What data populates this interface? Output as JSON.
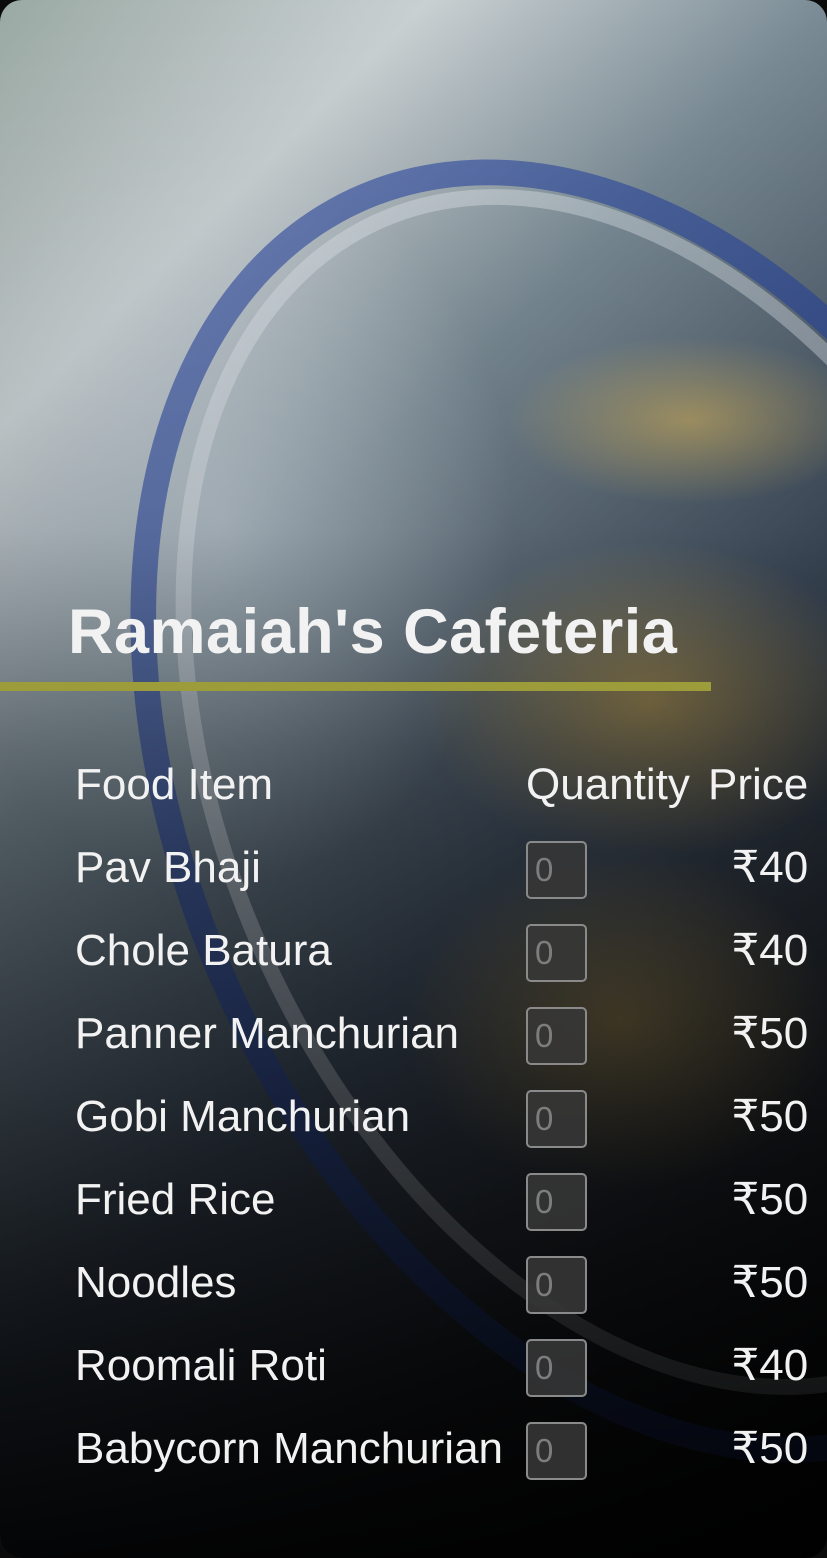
{
  "header": {
    "title": "Ramaiah's Cafeteria"
  },
  "table": {
    "headers": {
      "item": "Food Item",
      "quantity": "Quantity",
      "price": "Price"
    },
    "rows": [
      {
        "item": "Pav Bhaji",
        "quantity_placeholder": "0",
        "price": "₹40"
      },
      {
        "item": "Chole Batura",
        "quantity_placeholder": "0",
        "price": "₹40"
      },
      {
        "item": "Panner Manchurian",
        "quantity_placeholder": "0",
        "price": "₹50"
      },
      {
        "item": "Gobi Manchurian",
        "quantity_placeholder": "0",
        "price": "₹50"
      },
      {
        "item": "Fried Rice",
        "quantity_placeholder": "0",
        "price": "₹50"
      },
      {
        "item": "Noodles",
        "quantity_placeholder": "0",
        "price": "₹50"
      },
      {
        "item": "Roomali Roti",
        "quantity_placeholder": "0",
        "price": "₹40"
      },
      {
        "item": "Babycorn Manchurian",
        "quantity_placeholder": "0",
        "price": "₹50"
      }
    ]
  },
  "colors": {
    "accent_rule": "#9c9c3b",
    "text": "#f2f2f2"
  }
}
